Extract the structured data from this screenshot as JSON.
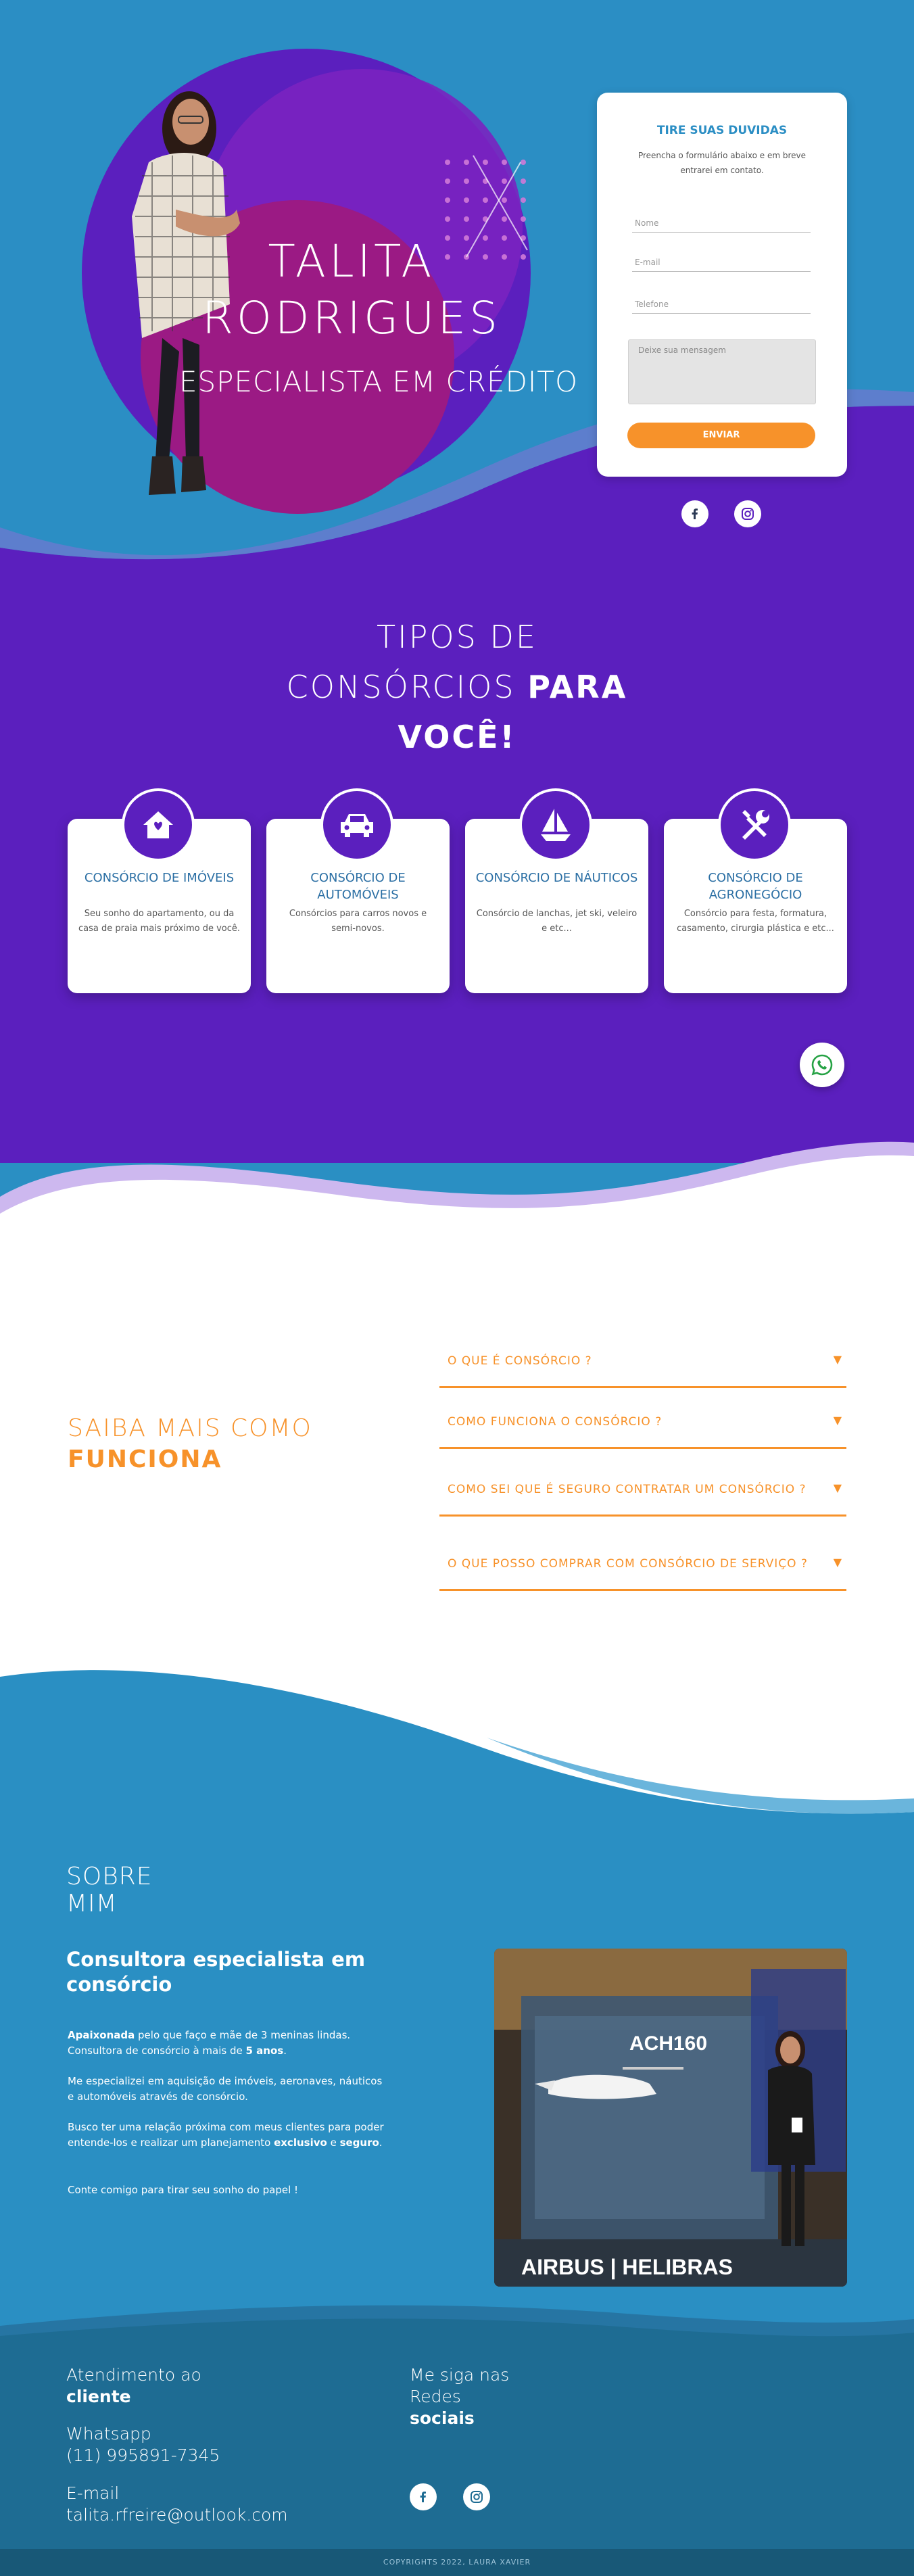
{
  "hero": {
    "title_line1": "TALITA",
    "title_line2": "RODRIGUES",
    "subtitle": "ESPECIALISTA EM CRÉDITO"
  },
  "contact_form": {
    "title": "TIRE SUAS DUVIDAS",
    "description": "Preencha o formulário abaixo e em breve entrarei em contato.",
    "name_placeholder": "Nome",
    "email_placeholder": "E-mail",
    "phone_placeholder": "Telefone",
    "message_placeholder": "Deixe sua mensagem",
    "submit_label": "ENVIAR"
  },
  "types": {
    "title_line1": "TIPOS DE",
    "title_line2a": "CONSÓRCIOS ",
    "title_line2b": "PARA",
    "title_line3": "VOCÊ!",
    "cards": [
      {
        "icon": "house-icon",
        "title": "CONSÓRCIO DE IMÓVEIS",
        "desc": "Seu sonho do apartamento, ou da casa de praia mais próximo de você."
      },
      {
        "icon": "car-icon",
        "title": "CONSÓRCIO DE AUTOMÓVEIS",
        "desc": "Consórcios para carros novos e semi-novos."
      },
      {
        "icon": "sailboat-icon",
        "title": "CONSÓRCIO DE NÁUTICOS",
        "desc": "Consórcio de lanchas, jet ski, veleiro e etc..."
      },
      {
        "icon": "tools-icon",
        "title": "CONSÓRCIO DE AGRONEGÓCIO",
        "desc": "Consórcio para festa, formatura, casamento, cirurgia plástica e etc..."
      }
    ]
  },
  "faq": {
    "heading_line1": "SAIBA MAIS COMO",
    "heading_line2": "FUNCIONA",
    "arrow": "▼",
    "items": [
      "O QUE É CONSÓRCIO ?",
      "COMO FUNCIONA O CONSÓRCIO ?",
      "COMO SEI QUE É SEGURO CONTRATAR UM CONSÓRCIO ?",
      "O QUE POSSO COMPRAR COM CONSÓRCIO DE SERVIÇO ?"
    ]
  },
  "about": {
    "heading_line1": "SOBRE",
    "heading_line2": "MIM",
    "subtitle": "Consultora especialista em consórcio",
    "p1_bold": "Apaixonada",
    "p1_a": " pelo que faço e mãe de 3 meninas lindas.",
    "p1_b": "Consultora de consórcio à mais de ",
    "p1_bold2": "5 anos",
    "p1_end": ".",
    "p2": "Me especializei em aquisição de imóveis, aeronaves, náuticos e automóveis através de consórcio.",
    "p3_a": "Busco ter uma relação próxima com meus clientes para poder entende-los e realizar um planejamento ",
    "p3_bold1": "exclusivo",
    "p3_b": " e ",
    "p3_bold2": "seguro",
    "p3_end": ".",
    "p4": "Conte comigo para tirar seu sonho do papel !",
    "photo_sign": "ACH160",
    "photo_banner": "AIRBUS | HELIBRAS"
  },
  "footer": {
    "service_label": "Atendimento ao",
    "service_bold": "cliente",
    "whatsapp_label": "Whatsapp",
    "whatsapp_number": "(11)  995891-7345",
    "email_label": "E-mail",
    "email_value": "talita.rfreire@outlook.com",
    "follow_line1": "Me siga nas",
    "follow_line2": "Redes",
    "follow_bold": "sociais",
    "copyright": "COPYRIGHTS 2022, LAURA XAVIER"
  },
  "colors": {
    "blue": "#2b8ec4",
    "purple": "#5b1fbe",
    "orange": "#f7922a",
    "magenta": "#9b1a84"
  }
}
